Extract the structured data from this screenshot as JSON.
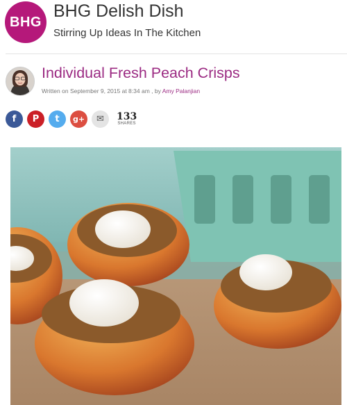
{
  "site": {
    "logo_text": "BHG",
    "title": "BHG Delish Dish",
    "tagline": "Stirring Up Ideas In The Kitchen",
    "brand_color": "#b5187a"
  },
  "post": {
    "title": "Individual Fresh Peach Crisps",
    "meta_prefix": "Written on September 9, 2015 at 8:34 am , by ",
    "author": "Amy Palanjian",
    "title_color": "#9b2a82"
  },
  "share": {
    "buttons": [
      {
        "icon": "facebook-icon",
        "glyph": "f",
        "color": "#3b5998"
      },
      {
        "icon": "pinterest-icon",
        "glyph": "P",
        "color": "#cb2027"
      },
      {
        "icon": "twitter-icon",
        "glyph": "t",
        "color": "#55acee"
      },
      {
        "icon": "google-plus-icon",
        "glyph": "g+",
        "color": "#dc4e41"
      },
      {
        "icon": "email-icon",
        "glyph": "✉",
        "color": "#e4e4e4"
      }
    ],
    "count": "133",
    "count_label": "SHARES"
  },
  "image": {
    "subject": "peach-crisps-photo"
  }
}
